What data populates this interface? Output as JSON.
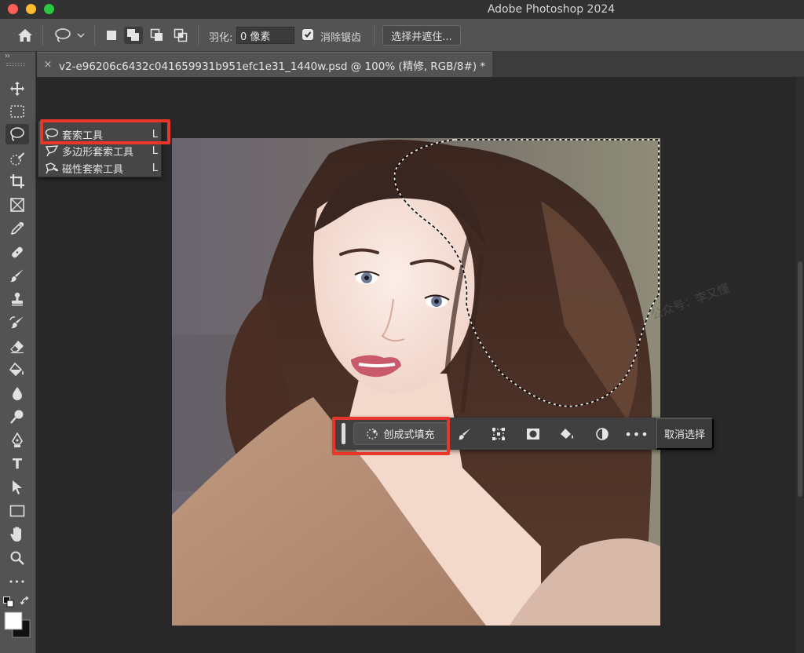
{
  "app": {
    "title": "Adobe Photoshop 2024"
  },
  "options_bar": {
    "feather_label": "羽化:",
    "feather_value": "0 像素",
    "antialias_label": "消除锯齿",
    "antialias_checked": true,
    "select_mask_label": "选择并遮住..."
  },
  "document": {
    "tab_label": "v2-e96206c6432c041659931b951efc1e31_1440w.psd @ 100% (精修, RGB/8#) *",
    "close_glyph": "×"
  },
  "toolbar": {
    "collapse_glyph": "››",
    "text_tool_glyph": "T",
    "more_glyph": "•••",
    "active_tool": "lasso-tool",
    "tools": [
      "move-tool",
      "marquee-tool",
      "lasso-tool",
      "quick-selection-tool",
      "crop-tool",
      "frame-tool",
      "eyedropper-tool",
      "healing-brush-tool",
      "brush-tool",
      "clone-stamp-tool",
      "history-brush-tool",
      "eraser-tool",
      "paint-bucket-tool",
      "blur-tool",
      "dodge-tool",
      "pen-tool",
      "type-tool",
      "path-selection-tool",
      "rectangle-tool",
      "hand-tool",
      "zoom-tool",
      "more-tools"
    ]
  },
  "lasso_flyout": {
    "items": [
      {
        "label": "套索工具",
        "shortcut": "L",
        "icon": "lasso-icon"
      },
      {
        "label": "多边形套索工具",
        "shortcut": "L",
        "icon": "polygonal-lasso-icon"
      },
      {
        "label": "磁性套索工具",
        "shortcut": "L",
        "icon": "magnetic-lasso-icon"
      }
    ]
  },
  "taskbar": {
    "generative_fill_label": "创成式填充",
    "more_glyph": "•••",
    "deselect_label": "取消选择"
  },
  "watermark": "公众号：李又懂",
  "colors": {
    "highlight_red": "#e8372a",
    "panel": "#535353",
    "canvas": "#282828"
  }
}
